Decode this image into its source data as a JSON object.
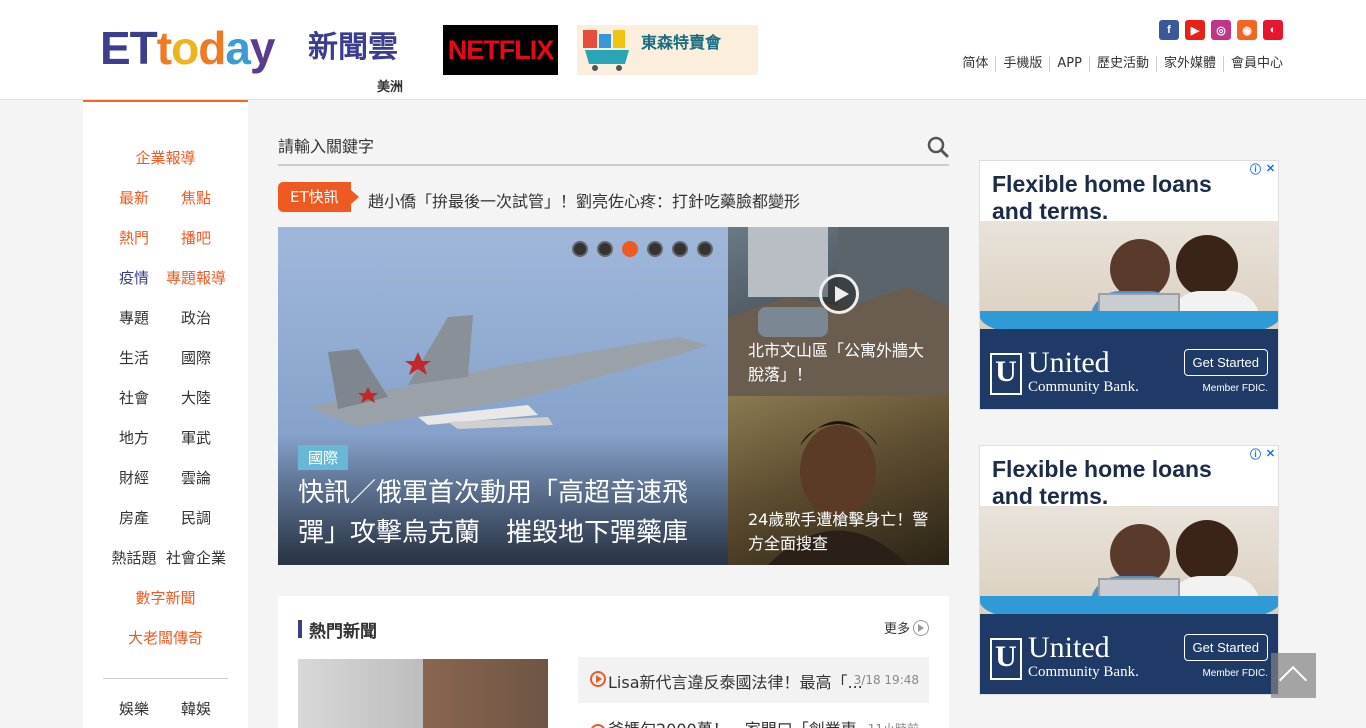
{
  "header": {
    "logo_text": "ETtoday",
    "logo_cn": "新聞雲",
    "region": "美洲",
    "netflix_banner": "NETFLIX",
    "promo_banner": "東森特賣會",
    "social_icons": [
      "facebook-icon",
      "youtube-icon",
      "instagram-icon",
      "rss-icon",
      "weibo-icon"
    ],
    "social_colors": [
      "#3b5998",
      "#e62117",
      "#c13584",
      "#f26522",
      "#e6162d"
    ],
    "nav": [
      "简体",
      "手機版",
      "APP",
      "歷史活動",
      "家外媒體",
      "會員中心"
    ]
  },
  "sidebar": {
    "top": "企業報導",
    "pairs": [
      [
        "最新",
        "焦點"
      ],
      [
        "熱門",
        "播吧"
      ],
      [
        "疫情",
        "專題報導"
      ],
      [
        "專題",
        "政治"
      ],
      [
        "生活",
        "國際"
      ],
      [
        "社會",
        "大陸"
      ],
      [
        "地方",
        "軍武"
      ],
      [
        "財經",
        "雲論"
      ],
      [
        "房產",
        "民調"
      ],
      [
        "熱話題",
        "社會企業"
      ]
    ],
    "digital": "數字新聞",
    "boss": "大老闆傳奇",
    "bottom_pair": [
      "娛樂",
      "韓娛"
    ]
  },
  "search": {
    "placeholder": "請輸入關鍵字"
  },
  "flash": {
    "tag": "ET快訊",
    "text": "趙小僑「拚最後一次試管」！劉亮佐心疼：打針吃藥臉都變形"
  },
  "hero": {
    "badge": "國際",
    "title": "快訊／俄軍首次動用「高超音速飛彈」攻擊烏克蘭　摧毀地下彈藥庫",
    "dots_total": 6,
    "dots_active": 3
  },
  "side_stories": [
    {
      "caption": "北市文山區「公寓外牆大脫落」！"
    },
    {
      "caption": "24歲歌手遭槍擊身亡！警方全面搜查"
    }
  ],
  "hot_news": {
    "title": "熱門新聞",
    "more": "更多",
    "items": [
      {
        "text": "Lisa新代言違反泰國法律！最高「...",
        "time": "3/18 19:48"
      },
      {
        "text": "爸媽勾2000萬！　家門口「創業專...",
        "time": "11小時前"
      }
    ]
  },
  "ads": [
    {
      "headline": "Flexible home loans and terms.",
      "bank": "United",
      "bank_sub": "Community Bank.",
      "cta": "Get Started",
      "fdic": "Member FDIC."
    },
    {
      "headline": "Flexible home loans and terms.",
      "bank": "United",
      "bank_sub": "Community Bank.",
      "cta": "Get Started",
      "fdic": "Member FDIC."
    }
  ]
}
